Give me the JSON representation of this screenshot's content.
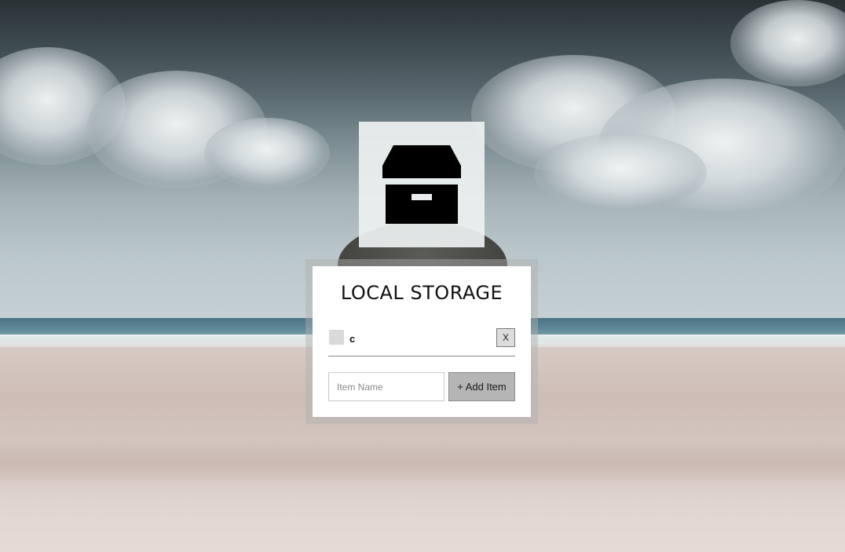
{
  "app": {
    "title": "LOCAL STORAGE",
    "icon": "archive-box-icon"
  },
  "items": [
    {
      "label": "c",
      "checked": false,
      "delete_label": "X"
    }
  ],
  "form": {
    "placeholder": "Item Name",
    "value": "",
    "add_label": "+ Add Item"
  },
  "colors": {
    "panel": "#ffffff",
    "button": "#b5b5b5",
    "checkbox": "#dadada",
    "icon": "#000000"
  }
}
